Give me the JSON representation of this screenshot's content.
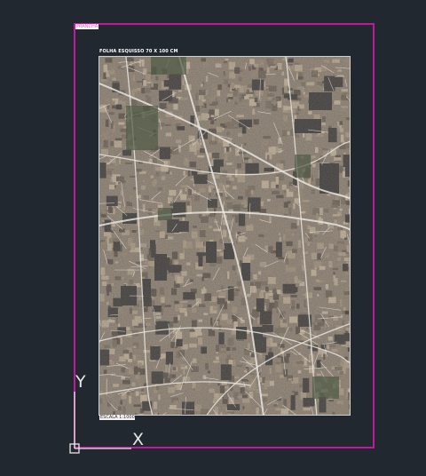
{
  "layout": {
    "tab_label": "PRANCHA",
    "sheet_title": "FOLHA ESQUISSO 70 X 100 CM",
    "scale_label": "ESCALA 1:1000"
  },
  "ucs": {
    "y_label": "Y",
    "x_label": "X"
  },
  "colors": {
    "background": "#212830",
    "layout_border": "#c0199e",
    "viewport_border": "#cfcfcf",
    "ucs_axis": "#e6e6e6"
  },
  "icons": {
    "ucs": "ucs-axis-icon"
  }
}
